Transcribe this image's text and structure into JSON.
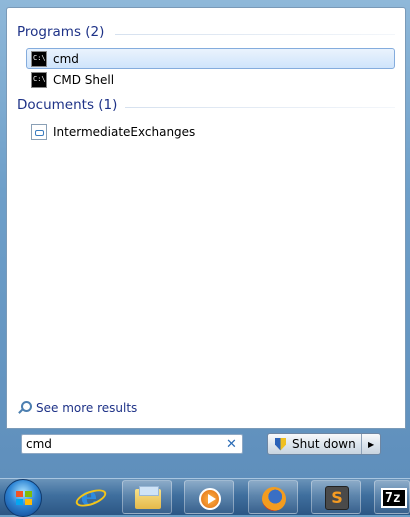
{
  "results": {
    "programs_header": "Programs (2)",
    "programs": [
      {
        "label": "cmd",
        "icon": "cmd-icon",
        "selected": true
      },
      {
        "label": "CMD Shell",
        "icon": "cmd-icon",
        "selected": false
      }
    ],
    "documents_header": "Documents (1)",
    "documents": [
      {
        "label": "IntermediateExchanges",
        "icon": "document-icon"
      }
    ],
    "see_more": "See more results"
  },
  "search": {
    "value": "cmd",
    "clear_glyph": "✕"
  },
  "shutdown": {
    "label": "Shut down",
    "arrow": "▶"
  },
  "taskbar": {
    "items": [
      {
        "icon": "start-orb-icon"
      },
      {
        "icon": "internet-explorer-icon",
        "glyph": "e"
      },
      {
        "icon": "windows-explorer-icon"
      },
      {
        "icon": "media-player-icon"
      },
      {
        "icon": "firefox-icon"
      },
      {
        "icon": "sublime-text-icon",
        "glyph": "S"
      },
      {
        "icon": "7zip-icon",
        "glyph": "7z"
      }
    ]
  },
  "colors": {
    "header_text": "#1e3287",
    "selection_border": "#84acdd",
    "taskbar": "#3f6f9e"
  }
}
